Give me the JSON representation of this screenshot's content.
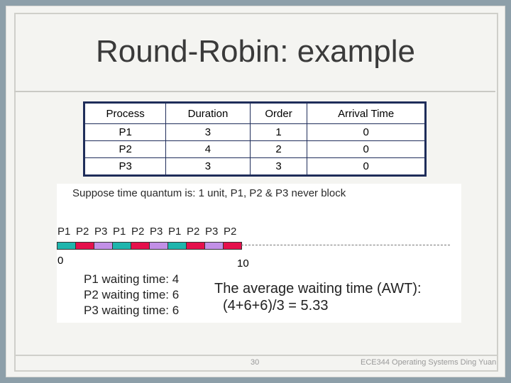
{
  "title": "Round-Robin: example",
  "table": {
    "headers": [
      "Process",
      "Duration",
      "Order",
      "Arrival Time"
    ],
    "rows": [
      [
        "P1",
        "3",
        "1",
        "0"
      ],
      [
        "P2",
        "4",
        "2",
        "0"
      ],
      [
        "P3",
        "3",
        "3",
        "0"
      ]
    ]
  },
  "suppose": "Suppose time quantum is: 1 unit, P1, P2 & P3 never block",
  "gantt": {
    "sequence": [
      "P1",
      "P2",
      "P3",
      "P1",
      "P2",
      "P3",
      "P1",
      "P2",
      "P3",
      "P2"
    ],
    "start_label": "0",
    "end_label": "10",
    "colors": {
      "P1": "#1fb5ad",
      "P2": "#e5104c",
      "P3": "#c28fe6"
    }
  },
  "waiting": [
    "P1 waiting time: 4",
    "P2 waiting time: 6",
    "P3 waiting time: 6"
  ],
  "awt": {
    "line1": "The average waiting time (AWT):",
    "line2": "(4+6+6)/3 = 5.33"
  },
  "footer": {
    "page": "30",
    "course": "ECE344 Operating Systems Ding Yuan"
  }
}
